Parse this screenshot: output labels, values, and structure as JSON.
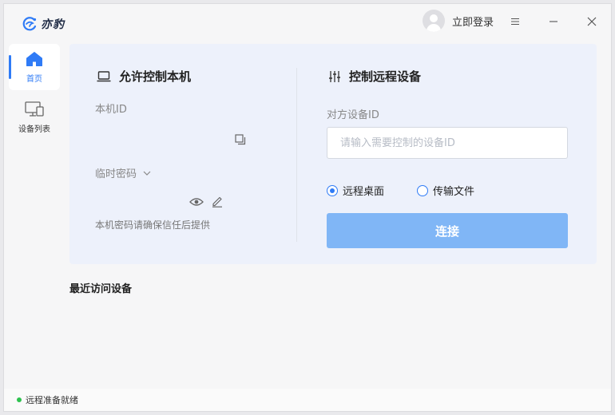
{
  "app": {
    "name": "亦豹"
  },
  "header": {
    "login_label": "立即登录"
  },
  "sidebar": {
    "items": [
      {
        "label": "首页",
        "icon": "home-icon",
        "active": true
      },
      {
        "label": "设备列表",
        "icon": "monitor-icon",
        "active": false
      }
    ]
  },
  "left_section": {
    "title": "允许控制本机",
    "device_id_label": "本机ID",
    "temp_password_label": "临时密码",
    "hint": "本机密码请确保信任后提供"
  },
  "right_section": {
    "title": "控制远程设备",
    "target_id_label": "对方设备ID",
    "target_id_placeholder": "请输入需要控制的设备ID",
    "target_id_value": "",
    "mode_options": [
      {
        "label": "远程桌面",
        "selected": true
      },
      {
        "label": "传输文件",
        "selected": false
      }
    ],
    "connect_label": "连接"
  },
  "recent": {
    "title": "最近访问设备"
  },
  "status": {
    "text": "远程准备就绪",
    "color": "#2ec24f"
  },
  "colors": {
    "accent": "#2f7bf6",
    "connect_button": "#80b6f6",
    "panel_bg": "#edf1fb"
  }
}
